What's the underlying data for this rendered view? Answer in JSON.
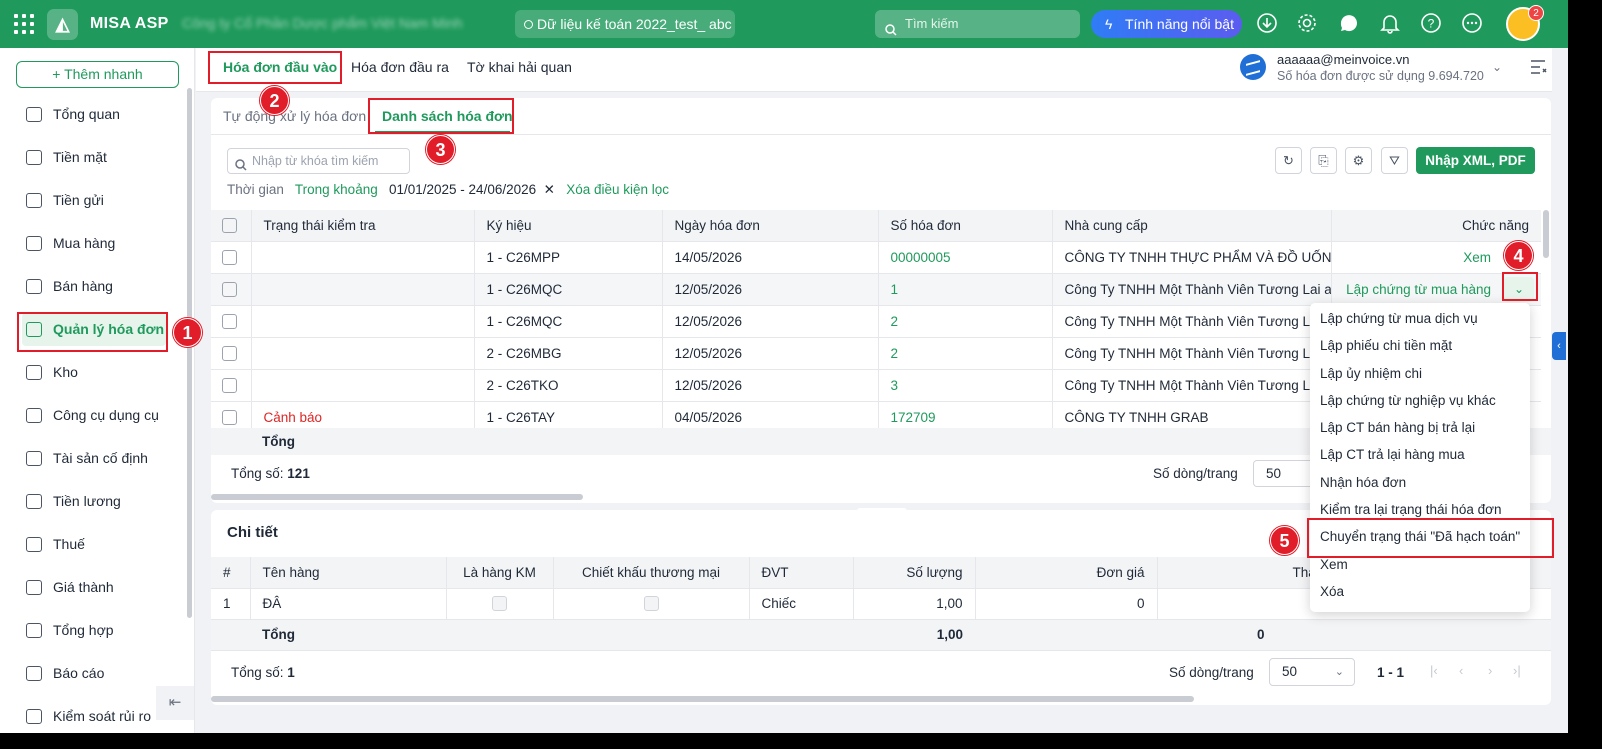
{
  "topbar": {
    "brand": "MISA ASP",
    "company": "Công ty Cổ Phần Dược phẩm Việt Nam Minh",
    "db": "Dữ liệu kế toán 2022_test_ abc",
    "search_placeholder": "Tìm kiếm",
    "feature": "Tính năng nổi bật",
    "badge": "2"
  },
  "sidebar": {
    "quick_add": "+ Thêm nhanh",
    "items": [
      "Tổng quan",
      "Tiền mặt",
      "Tiền gửi",
      "Mua hàng",
      "Bán hàng",
      "Quản lý hóa đơn",
      "Kho",
      "Công cụ dụng cụ",
      "Tài sản cố định",
      "Tiền lương",
      "Thuế",
      "Giá thành",
      "Tổng hợp",
      "Báo cáo",
      "Kiểm soát rủi ro"
    ]
  },
  "subnav": {
    "tabs": [
      "Hóa đơn đầu vào",
      "Hóa đơn đầu ra",
      "Tờ khai hải quan"
    ],
    "account_email": "aaaaaa@meinvoice.vn",
    "account_usage": "Số hóa đơn được sử dụng 9.694.720"
  },
  "main": {
    "tabs": [
      "Tự động xử lý hóa đơn",
      "Danh sách hóa đơn"
    ],
    "search_placeholder": "Nhập từ khóa tìm kiếm",
    "filter": {
      "label": "Thời gian",
      "mode": "Trong khoảng",
      "range": "01/01/2025 - 24/06/2026",
      "clear": "Xóa điều kiện lọc"
    },
    "import_button": "Nhập XML, PDF",
    "columns": [
      "Trạng thái kiểm tra",
      "Ký hiệu",
      "Ngày hóa đơn",
      "Số hóa đơn",
      "Nhà cung cấp",
      "Chức năng"
    ],
    "rows": [
      {
        "status": "",
        "symbol": "1 - C26MPP",
        "date": "14/05/2026",
        "number": "00000005",
        "supplier": "CÔNG TY TNHH THỰC PHẨM VÀ ĐỒ UỐNG",
        "action": "Xem"
      },
      {
        "status": "",
        "symbol": "1 - C26MQC",
        "date": "12/05/2026",
        "number": "1",
        "supplier": "Công Ty TNHH Một Thành Viên Tương Lai ab",
        "action": "Lập chứng từ mua hàng"
      },
      {
        "status": "",
        "symbol": "1 - C26MQC",
        "date": "12/05/2026",
        "number": "2",
        "supplier": "Công Ty TNHH Một Thành Viên Tương Lai",
        "action": ""
      },
      {
        "status": "",
        "symbol": "2 - C26MBG",
        "date": "12/05/2026",
        "number": "2",
        "supplier": "Công Ty TNHH Một Thành Viên Tương Lai",
        "action": ""
      },
      {
        "status": "",
        "symbol": "2 - C26TKO",
        "date": "12/05/2026",
        "number": "3",
        "supplier": "Công Ty TNHH Một Thành Viên Tương Lai",
        "action": ""
      },
      {
        "status": "Cảnh báo",
        "symbol": "1 - C26TAY",
        "date": "04/05/2026",
        "number": "172709",
        "supplier": "CÔNG TY TNHH GRAB",
        "action": ""
      }
    ],
    "total_label": "Tổng",
    "count_label": "Tổng số:",
    "count": "121",
    "rows_per_page_label": "Số dòng/trang",
    "rows_per_page": "50"
  },
  "detail": {
    "title": "Chi tiết",
    "columns": [
      "#",
      "Tên hàng",
      "Là hàng KM",
      "Chiết khấu thương mại",
      "ĐVT",
      "Số lượng",
      "Đơn giá",
      "Thành tiền"
    ],
    "rows": [
      {
        "no": "1",
        "name": "ĐÂ",
        "unit": "Chiếc",
        "qty": "1,00",
        "price": "0"
      }
    ],
    "total_label": "Tổng",
    "total_qty": "1,00",
    "total_amount": "0",
    "count_label": "Tổng số:",
    "count": "1",
    "rows_per_page_label": "Số dòng/trang",
    "rows_per_page": "50",
    "pager": "1 - 1"
  },
  "dropdown": [
    "Lập chứng từ mua dịch vụ",
    "Lập phiếu chi tiền mặt",
    "Lập ủy nhiệm chi",
    "Lập chứng từ nghiệp vụ khác",
    "Lập CT bán hàng bị trả lại",
    "Lập CT trả lại hàng mua",
    "Nhận hóa đơn",
    "Kiểm tra lại trạng thái hóa đơn",
    "Chuyển trạng thái \"Đã hạch toán\"",
    "Xem",
    "Xóa"
  ],
  "annotations": [
    "1",
    "2",
    "3",
    "4",
    "5"
  ]
}
